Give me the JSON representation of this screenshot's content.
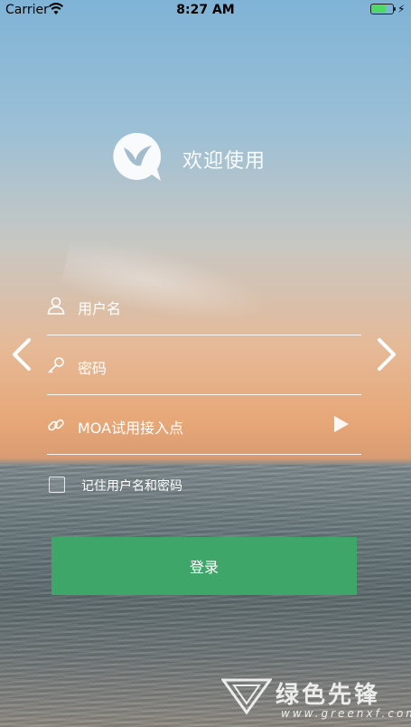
{
  "status_bar": {
    "carrier": "Carrier",
    "time": "8:27 AM",
    "battery_level": 0.8,
    "icons": [
      "wifi-icon",
      "battery-icon",
      "charging-bolt-icon"
    ]
  },
  "header": {
    "welcome_text": "欢迎使用",
    "logo_icon": "bird-speech-bubble-icon"
  },
  "form": {
    "username_placeholder": "用户名",
    "password_placeholder": "密码",
    "endpoint_placeholder": "MOA试用接入点",
    "remember_label": "记住用户名和密码",
    "remember_checked": false,
    "login_label": "登录"
  },
  "navigation": {
    "prev_icon": "chevron-left-icon",
    "next_icon": "chevron-right-icon"
  },
  "watermark": {
    "text": "绿色先锋",
    "url": "www.greenxf.com"
  },
  "colors": {
    "login_button": "#3fa66a",
    "field_text": "#ffffff"
  }
}
